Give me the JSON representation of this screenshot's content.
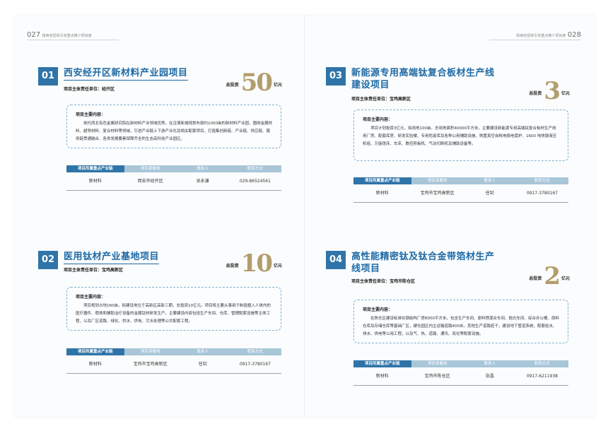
{
  "header": {
    "left_page_num": "027",
    "left_title": "陕西省招商引资重点推介项目册",
    "right_title": "陕西省招商引资重点推介项目册",
    "right_page_num": "028"
  },
  "table_headers": [
    "项目所属重点产业链",
    "项目承载地",
    "联系人",
    "联系方式"
  ],
  "projects": [
    {
      "num": "01",
      "title": "西安经开区新材料产业园项目",
      "owner": "项目主体责任单位：经开区",
      "invest_prefix": "总投资",
      "invest_value": "50",
      "invest_unit": "亿元",
      "intro_label": "项目主要内容：",
      "intro_text": "依托西北有色金属研究院在新材料产业领域优势，在泾渭新城规划布局约1000亩的新材料产业园，围绕金属材料、超导材料、复合材料等领域，引进产业链上下游产业化及相关配套项目，打造集创新链、产业链、供应链、服务链贯通融合、各类发展要素保障齐全的生态高科技产业园区。",
      "row": [
        "新材料",
        "西安市经开区",
        "吴永谦",
        "029-86524561"
      ]
    },
    {
      "num": "02",
      "title": "医用钛材产业基地项目",
      "owner": "项目主体责任单位：宝鸡高新区",
      "invest_prefix": "总投资",
      "invest_value": "10",
      "invest_unit": "亿元",
      "intro_label": "项目主要内容：",
      "intro_text": "项目规划占地160亩，拟建设地位于高新区高新三期，总投资10亿元。项目将主要从事用于制造植入人体内的医疗器件、假体和辅助治疗设备的金属钛材研发生产。主要建设内容包括生产车间、仓库、管理配套设施等主体工程，以及厂区道路、绿化、供水、供电、污水处理等公共配套工程。",
      "row": [
        "新材料",
        "宝鸡市宝鸡高新区",
        "任钊",
        "0917-3780167"
      ]
    },
    {
      "num": "03",
      "title": "新能源专用高端钛复合板材生产线建设项目",
      "owner": "项目主体责任单位：宝鸡高新区",
      "invest_prefix": "总投资",
      "invest_value": "3",
      "invest_unit": "亿元",
      "intro_label": "项目主要内容：",
      "intro_text": "项目计划投资3亿元，拟用地100亩，总用地面积40000平方米，主要建设新能源专用高端钛复合板材生产线用厂房、配套库房、研发实验楼、专用危废库及各种公用辅助设施，购置真空自耗电极电弧炉、1600 吨快锻液压机组、万能铣床、车床、数控剪板机、气动切断机及辅助设备等。",
      "row": [
        "新材料",
        "宝鸡市宝鸡高新区",
        "任钊",
        "0917-3780167"
      ]
    },
    {
      "num": "04",
      "title": "高性能精密钛及钛合金带箔材生产线项目",
      "owner": "项目主体责任单位：宝鸡市陈仓区",
      "invest_prefix": "总投资",
      "invest_value": "2",
      "invest_unit": "亿元",
      "intro_label": "项目主要内容：",
      "intro_text": "在陈仓区建设标准化钢结构厂房8000平方米，包含生产车间、原料预混合车间、抛光车间、综合办公楼、原料仓库及存储仓库等基础厂区，硬化园区内主运输道路400米。其他生产道路若干，建设地下管道系统，配套给水、排水、供电等公用工程，以及气、热、道路、通讯、亮化等配套设施。",
      "row": [
        "新材料",
        "宝鸡市陈仓区",
        "张晶",
        "0917-6211938"
      ]
    }
  ]
}
